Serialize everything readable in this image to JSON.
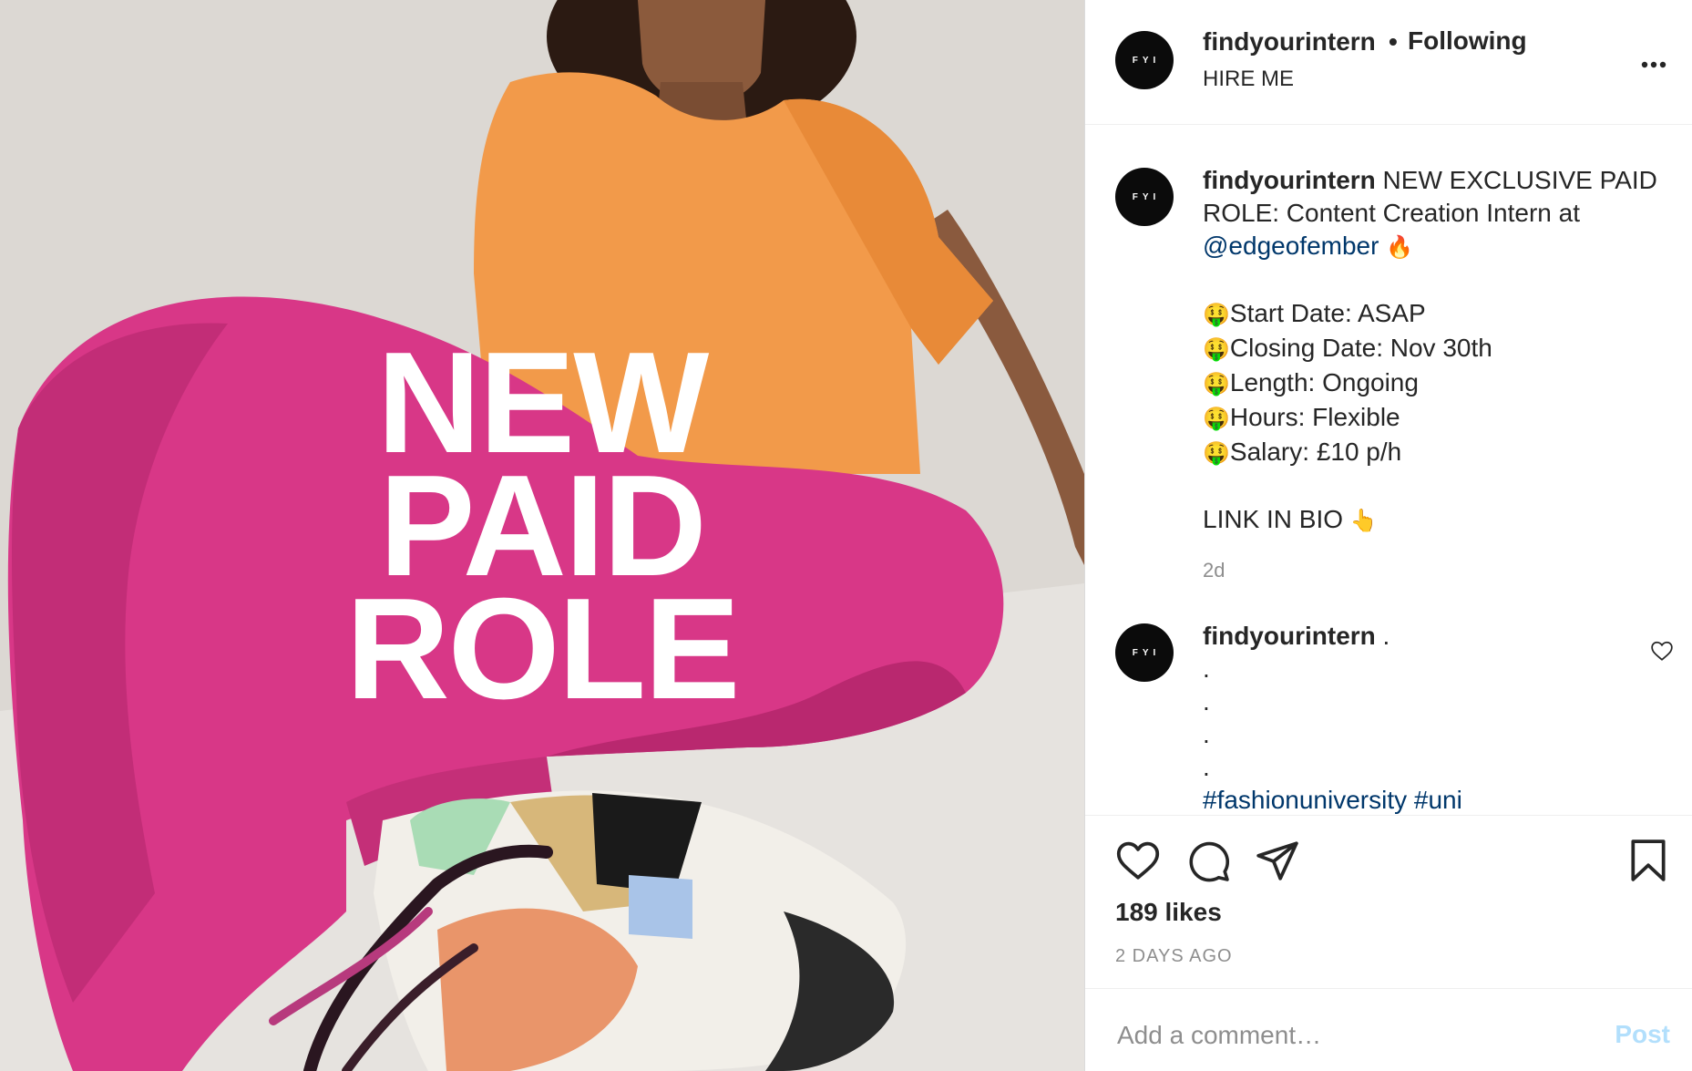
{
  "post": {
    "overlay_lines": [
      "NEW",
      "PAID",
      "ROLE"
    ]
  },
  "header": {
    "avatar_text": "FYI",
    "username": "findyourintern",
    "dot": "•",
    "follow_status": "Following",
    "subtitle": "HIRE ME",
    "more_icon": "more-icon"
  },
  "caption": {
    "avatar_text": "FYI",
    "username": "findyourintern",
    "text_1": "NEW EXCLUSIVE PAID ROLE: Content Creation Intern at",
    "mention": "@edgeofember",
    "fire_emoji": "🔥",
    "money_emoji": "🤑",
    "details": [
      "Start Date: ASAP",
      "Closing Date: Nov 30th",
      "Length: Ongoing",
      "Hours: Flexible",
      "Salary: £10 p/h"
    ],
    "link_text": "LINK IN BIO",
    "point_emoji": "👆",
    "timestamp": "2d"
  },
  "comment": {
    "avatar_text": "FYI",
    "username": "findyourintern",
    "text": ".",
    "dots": [
      ".",
      ".",
      ".",
      "."
    ],
    "hashtags": "#fashionuniversity #uni"
  },
  "actions": {
    "likes": "189 likes",
    "date": "2 DAYS AGO"
  },
  "add_comment": {
    "placeholder": "Add a comment…",
    "post_label": "Post"
  },
  "colors": {
    "link": "#00376b",
    "muted": "#8e8e8e",
    "post_button_disabled": "#b2dffc",
    "avatar_bg": "#0b0b0b"
  }
}
